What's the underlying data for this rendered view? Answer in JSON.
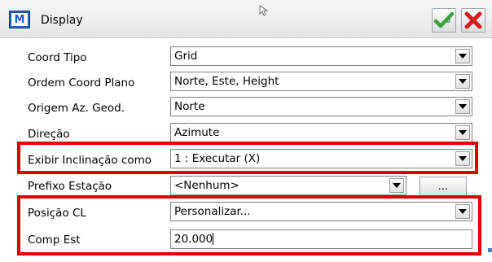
{
  "window": {
    "app_icon_glyph": "M",
    "title": "Display"
  },
  "form": {
    "coord_tipo": {
      "label": "Coord Tipo",
      "value": "Grid"
    },
    "ordem_coord": {
      "label": "Ordem Coord Plano",
      "value": "Norte, Este, Height"
    },
    "origem_az": {
      "label": "Origem Az. Geod.",
      "value": "Norte"
    },
    "direcao": {
      "label": "Direção",
      "value": "Azimute"
    },
    "exibir_inclinacao": {
      "label": "Exibir Inclinação como",
      "value": "1 : Executar (X)"
    },
    "prefixo_estacao": {
      "label": "Prefixo Estação",
      "value": "<Nenhum>",
      "button_label": "..."
    },
    "posicao_cl": {
      "label": "Posição CL",
      "value": "Personalizar..."
    },
    "comp_est": {
      "label": "Comp Est",
      "value": "20.000"
    }
  },
  "icons": {
    "ok": "check-icon",
    "cancel": "close-icon",
    "dropdown": "chevron-down-icon"
  },
  "colors": {
    "highlight": "#e00000",
    "app_icon": "#1f5fbf",
    "check": "#3aa13a",
    "close": "#d41c1c"
  }
}
